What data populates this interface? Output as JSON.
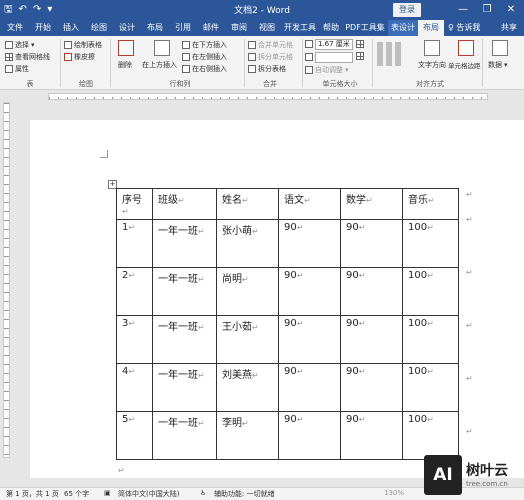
{
  "title_bar": {
    "doc_title": "文档2  -  Word",
    "login": "登录",
    "qat": {
      "save_icon": "save-icon",
      "undo_glyph": "↶",
      "redo_glyph": "↷",
      "customize_glyph": "▾",
      "save_glyph": "🖫"
    },
    "controls": {
      "minimize": "—",
      "restore": "❐",
      "close": "✕"
    }
  },
  "tabs": [
    "文件",
    "开始",
    "插入",
    "绘图",
    "设计",
    "布局",
    "引用",
    "邮件",
    "审阅",
    "视图",
    "开发工具",
    "帮助",
    "PDF工具集",
    "表设计",
    "布局",
    "告诉我",
    "共享"
  ],
  "tell_me_icon": "lightbulb-icon",
  "ribbon": {
    "table_group": {
      "select": "选择",
      "gridlines": "查看网格线",
      "properties": "属性",
      "label": "表"
    },
    "draw_group": {
      "draw_table": "绘制表格",
      "eraser": "橡皮擦",
      "label": "绘图"
    },
    "delete": "删除",
    "rows_cols": {
      "insert_above": "在上方插入",
      "insert_below": "在下方插入",
      "insert_left": "在左侧插入",
      "insert_right": "在右侧插入",
      "label": "行和列"
    },
    "merge": {
      "merge_cells": "合并单元格",
      "split_cells": "拆分单元格",
      "split_table": "拆分表格",
      "label": "合并"
    },
    "cell_size": {
      "height": "1.67 厘米",
      "width": "",
      "autofit": "自动调整",
      "label": "单元格大小"
    },
    "alignment": {
      "text_direction": "文字方向",
      "cell_margins": "单元格边距",
      "label": "对齐方式"
    },
    "data": "数据"
  },
  "table": {
    "headers": [
      "序号",
      "班级",
      "姓名",
      "语文",
      "数学",
      "音乐"
    ],
    "rows": [
      [
        "1",
        "一年一班",
        "张小萌",
        "90",
        "90",
        "100"
      ],
      [
        "2",
        "一年一班",
        "尚明",
        "90",
        "90",
        "100"
      ],
      [
        "3",
        "一年一班",
        "王小茹",
        "90",
        "90",
        "100"
      ],
      [
        "4",
        "一年一班",
        "刘美燕",
        "90",
        "90",
        "100"
      ],
      [
        "5",
        "一年一班",
        "李明",
        "90",
        "90",
        "100"
      ]
    ],
    "cell_mark": "↵"
  },
  "status": {
    "page": "第 1 页，共 1 页",
    "words": "65 个字",
    "language": "简体中文(中国大陆)",
    "accessibility": "辅助功能: 一切就绪",
    "zoom": "130%"
  },
  "watermark": {
    "box": "AI",
    "brand": "树叶云",
    "sub": "tree.com.cn"
  }
}
